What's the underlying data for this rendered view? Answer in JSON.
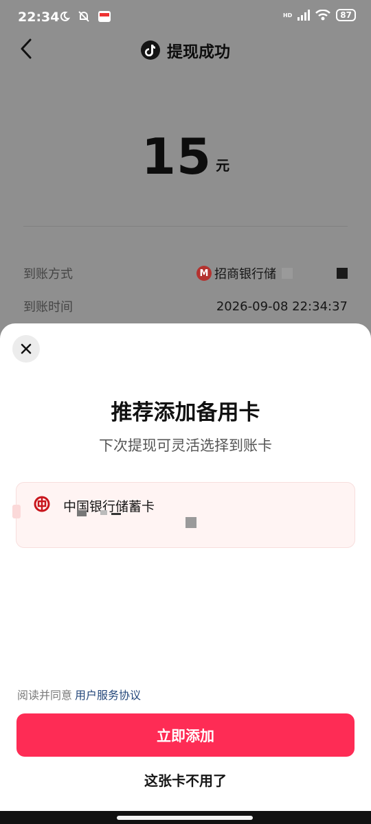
{
  "status_bar": {
    "time": "22:34",
    "battery": "87",
    "network_badge": "HD"
  },
  "header": {
    "title": "提现成功"
  },
  "amount": {
    "value": "15",
    "unit": "元"
  },
  "details": {
    "rows": [
      {
        "label": "到账方式",
        "value": "招商银行储"
      },
      {
        "label": "到账时间",
        "value": "2026-09-08 22:34:37"
      }
    ]
  },
  "sheet": {
    "title": "推荐添加备用卡",
    "subtitle": "下次提现可灵活选择到账卡",
    "card": {
      "bank_name": "中国银行储蓄卡"
    },
    "agreement": {
      "prefix": "阅读并同意",
      "link": "用户服务协议"
    },
    "add_button": "立即添加",
    "skip_button": "这张卡不用了"
  },
  "colors": {
    "accent": "#fe2c55",
    "link": "#22467a",
    "cmb_red": "#b4322f",
    "boc_red": "#c8161d"
  },
  "icons": [
    "back-icon",
    "douyin-logo-icon",
    "close-icon",
    "boc-logo-icon",
    "cmb-logo-icon",
    "wifi-icon",
    "signal-icon",
    "battery-icon",
    "moon-icon"
  ]
}
